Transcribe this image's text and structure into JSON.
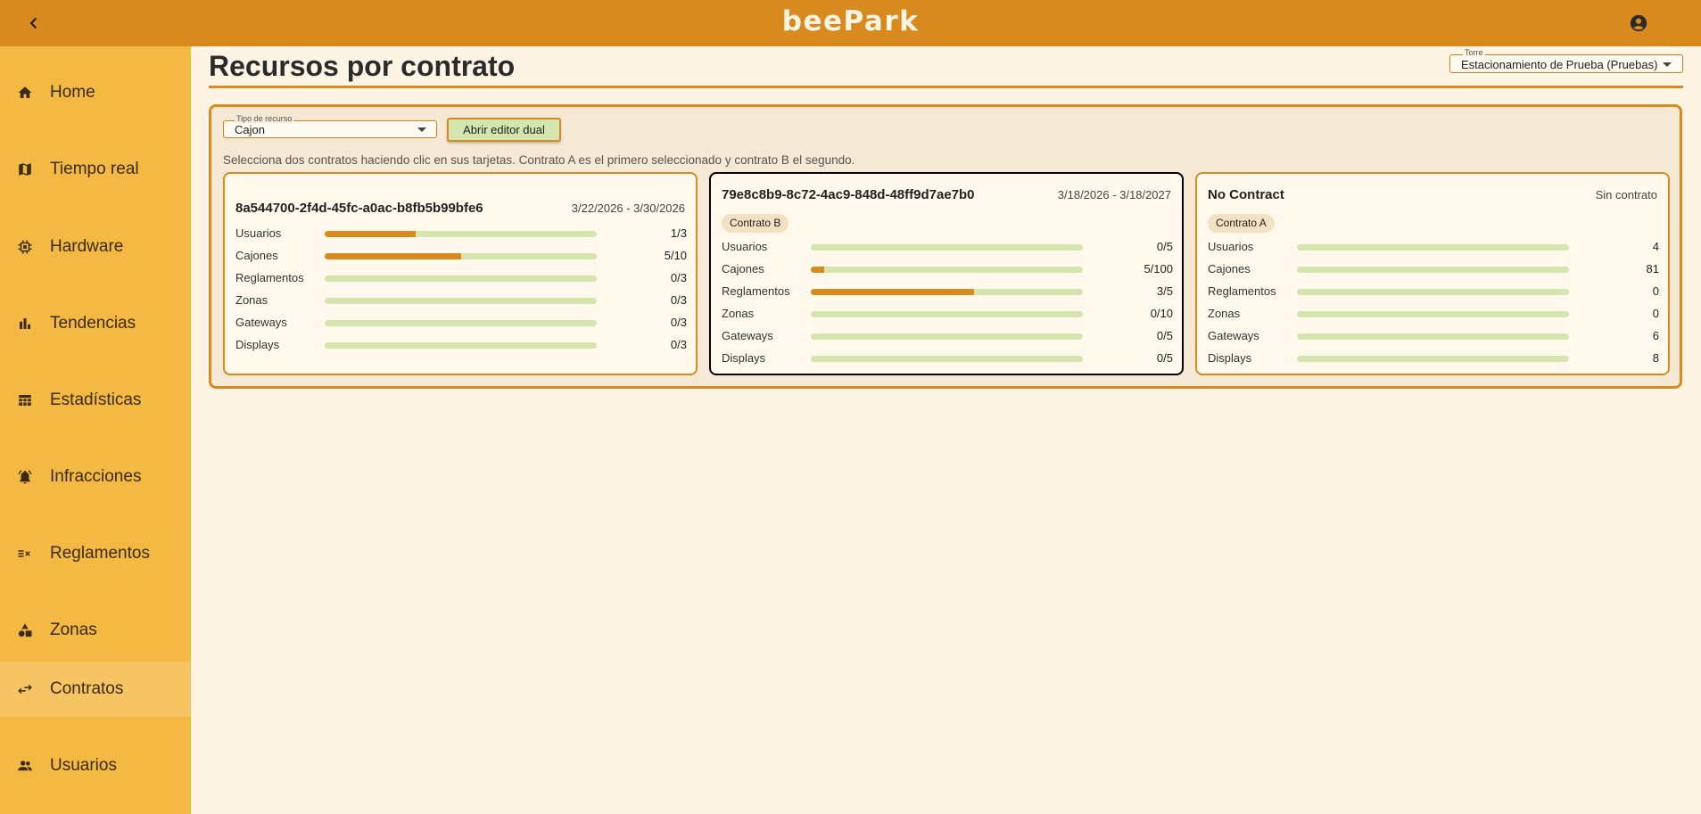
{
  "app": {
    "brand": "beePark"
  },
  "sidebar": {
    "items": [
      {
        "label": "Home",
        "icon": "home-icon",
        "active": false
      },
      {
        "label": "Tiempo real",
        "icon": "map-icon",
        "active": false
      },
      {
        "label": "Hardware",
        "icon": "chip-icon",
        "active": false
      },
      {
        "label": "Tendencias",
        "icon": "bar-chart-icon",
        "active": false
      },
      {
        "label": "Estadísticas",
        "icon": "table-icon",
        "active": false
      },
      {
        "label": "Infracciones",
        "icon": "alarm-icon",
        "active": false
      },
      {
        "label": "Reglamentos",
        "icon": "rule-icon",
        "active": false
      },
      {
        "label": "Zonas",
        "icon": "shapes-icon",
        "active": false
      },
      {
        "label": "Contratos",
        "icon": "swap-icon",
        "active": true
      },
      {
        "label": "Usuarios",
        "icon": "people-icon",
        "active": false
      }
    ]
  },
  "page": {
    "title": "Recursos por contrato",
    "torre": {
      "label": "Torre",
      "value": "Estacionamiento de Prueba (Pruebas)"
    }
  },
  "controls": {
    "tipo_recurso": {
      "label": "Tipo de recurso",
      "value": "Cajon"
    },
    "dual_editor_button": "Abrir editor dual",
    "hint": "Selecciona dos contratos haciendo clic en sus tarjetas. Contrato A es el primero seleccionado y contrato B el segundo."
  },
  "colors": {
    "accent": "#d98a1e",
    "sidebar": "#f4b942",
    "track": "#d4e6ae",
    "background": "#fdf4e3"
  },
  "cards": [
    {
      "title": "8a544700-2f4d-45fc-a0ac-b8fb5b99bfe6",
      "date": "3/22/2026 - 3/30/2026",
      "chip": "",
      "selected": "",
      "rows": [
        {
          "label": "Usuarios",
          "value": "1/3",
          "fraction": 0.333
        },
        {
          "label": "Cajones",
          "value": "5/10",
          "fraction": 0.5
        },
        {
          "label": "Reglamentos",
          "value": "0/3",
          "fraction": 0
        },
        {
          "label": "Zonas",
          "value": "0/3",
          "fraction": 0
        },
        {
          "label": "Gateways",
          "value": "0/3",
          "fraction": 0
        },
        {
          "label": "Displays",
          "value": "0/3",
          "fraction": 0
        }
      ]
    },
    {
      "title": "79e8c8b9-8c72-4ac9-848d-48ff9d7ae7b0",
      "date": "3/18/2026 - 3/18/2027",
      "chip": "Contrato B",
      "selected": "B",
      "rows": [
        {
          "label": "Usuarios",
          "value": "0/5",
          "fraction": 0
        },
        {
          "label": "Cajones",
          "value": "5/100",
          "fraction": 0.05
        },
        {
          "label": "Reglamentos",
          "value": "3/5",
          "fraction": 0.6
        },
        {
          "label": "Zonas",
          "value": "0/10",
          "fraction": 0
        },
        {
          "label": "Gateways",
          "value": "0/5",
          "fraction": 0
        },
        {
          "label": "Displays",
          "value": "0/5",
          "fraction": 0
        }
      ]
    },
    {
      "title": "No Contract",
      "date": "Sin contrato",
      "chip": "Contrato A",
      "selected": "A",
      "rows": [
        {
          "label": "Usuarios",
          "value": "4",
          "fraction": 0
        },
        {
          "label": "Cajones",
          "value": "81",
          "fraction": 0
        },
        {
          "label": "Reglamentos",
          "value": "0",
          "fraction": 0
        },
        {
          "label": "Zonas",
          "value": "0",
          "fraction": 0
        },
        {
          "label": "Gateways",
          "value": "6",
          "fraction": 0
        },
        {
          "label": "Displays",
          "value": "8",
          "fraction": 0
        }
      ]
    }
  ]
}
